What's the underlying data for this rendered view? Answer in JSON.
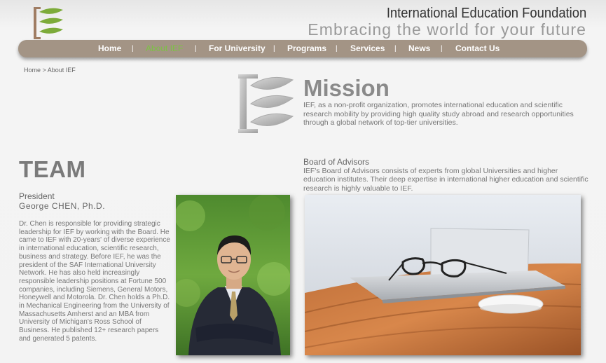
{
  "header": {
    "org_name": "International Education Foundation",
    "tagline": "Embracing the world for your future"
  },
  "nav": {
    "items": [
      {
        "label": "Home",
        "active": false
      },
      {
        "label": "About IEF",
        "active": true
      },
      {
        "label": "For University",
        "active": false
      },
      {
        "label": "Programs",
        "active": false
      },
      {
        "label": "Services",
        "active": false
      },
      {
        "label": "News",
        "active": false
      },
      {
        "label": "Contact Us",
        "active": false
      }
    ],
    "separator": "|"
  },
  "breadcrumb": "Home > About IEF",
  "mission": {
    "title": "Mission",
    "text": "IEF, as a non-profit organization, promotes international education and scientific research mobility by providing high quality study abroad and research opportunities through a global network of top-tier universities."
  },
  "team": {
    "title": "TEAM",
    "role": "President",
    "name": "George CHEN, Ph.D.",
    "bio": "Dr. Chen is responsible for providing strategic leadership for IEF by working with the Board. He came to IEF with 20-years' of diverse experience in international education, scientific research, business and strategy. Before IEF, he was the president of the SAF International University Network. He has also held increasingly responsible leadership positions at Fortune 500 companies, including Siemens, General Motors, Honeywell and Motorola. Dr. Chen holds a Ph.D. in Mechanical Engineering from the University of Massachusetts Amherst and an MBA from University of Michigan's Ross School of Business. He published 12+ research papers and generated 5 patents."
  },
  "board": {
    "title": "Board of Advisors",
    "text": "IEF's Board of Advisors consists of experts from global Universities and higher education institutes. Their deep expertise in international higher education and scientific research is highly valuable to IEF."
  },
  "colors": {
    "nav_bg": "#a39485",
    "nav_active": "#7cc244",
    "leaf_green": "#6aa84f"
  }
}
